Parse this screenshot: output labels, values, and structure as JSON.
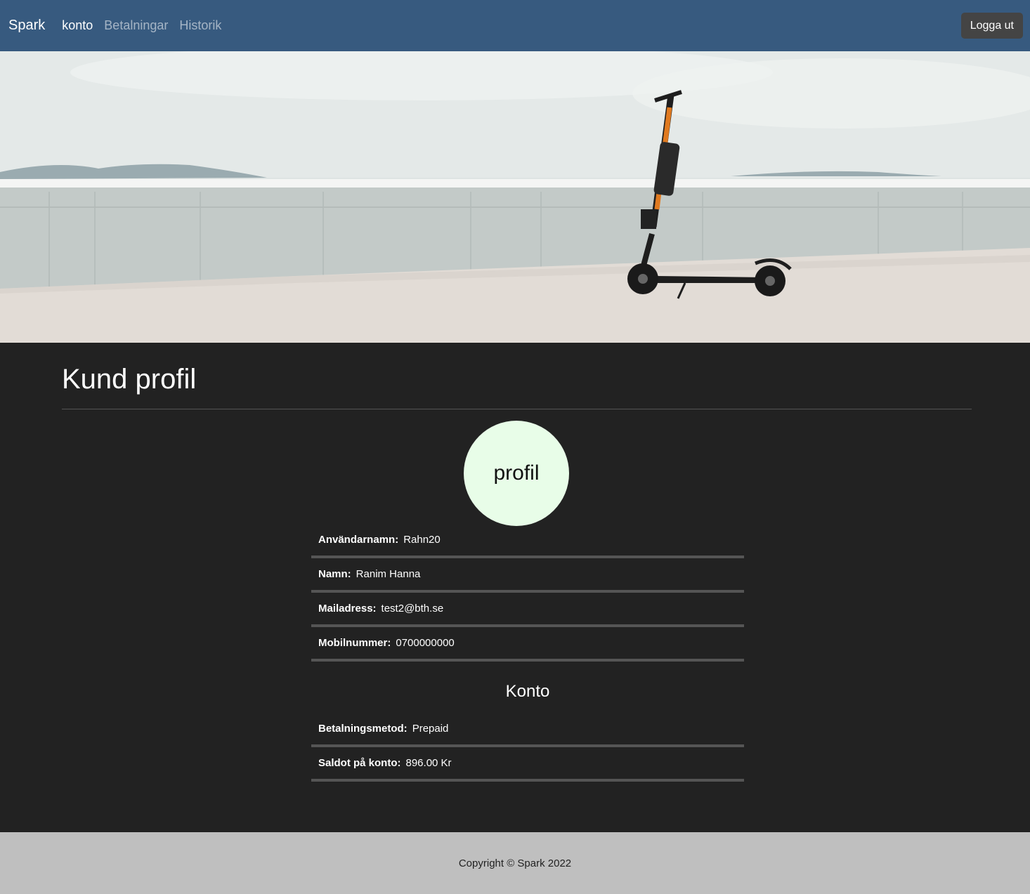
{
  "navbar": {
    "brand": "Spark",
    "links": [
      "konto",
      "Betalningar",
      "Historik"
    ],
    "logout": "Logga ut"
  },
  "hero": {
    "image": "electric-scooter-photo"
  },
  "profile": {
    "title": "Kund profil",
    "avatar_text": "profil",
    "fields": [
      {
        "label": "Användarnamn:",
        "value": "Rahn20"
      },
      {
        "label": "Namn:",
        "value": "Ranim Hanna"
      },
      {
        "label": "Mailadress:",
        "value": "test2@bth.se"
      },
      {
        "label": "Mobilnummer:",
        "value": "0700000000"
      }
    ]
  },
  "account": {
    "title": "Konto",
    "fields": [
      {
        "label": "Betalningsmetod:",
        "value": "Prepaid"
      },
      {
        "label": "Saldot på konto:",
        "value": "896.00 Kr"
      }
    ]
  },
  "footer": {
    "text": "Copyright © Spark 2022"
  },
  "colors": {
    "navbar": "#375a7f",
    "body": "#222222",
    "footer": "#bfbfbf",
    "avatar": "#e8fde8"
  }
}
